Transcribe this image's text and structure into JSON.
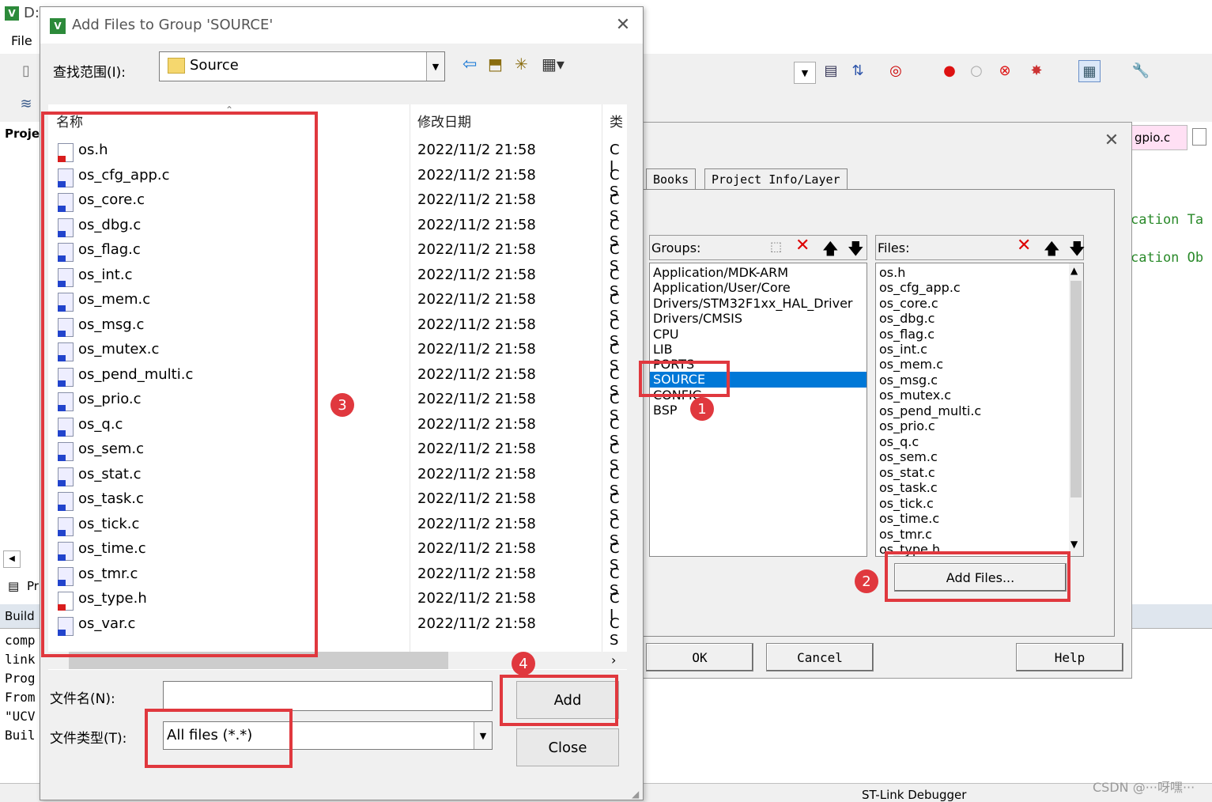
{
  "ide": {
    "title_fragment": "D:",
    "menu_file": "File",
    "project_tab_label": "Projec",
    "project_bottom_tab": "Pr",
    "build_label": "Build",
    "build_lines": [
      "comp",
      "link",
      "Prog",
      "From",
      "\"UCV",
      "Buil"
    ],
    "editor_tab": "gpio.c",
    "code_lines": [
      "cation Ta",
      "cation Ob"
    ],
    "status_right": "ST-Link Debugger",
    "watermark": "CSDN @···呀嘿···"
  },
  "add_dialog": {
    "title": "Add Files to Group 'SOURCE'",
    "lookin_label": "查找范围(I):",
    "lookin_value": "Source",
    "columns": {
      "name": "名称",
      "date": "修改日期",
      "type": "类"
    },
    "files": [
      {
        "name": "os.h",
        "date": "2022/11/2 21:58",
        "type": "C I",
        "kind": "h"
      },
      {
        "name": "os_cfg_app.c",
        "date": "2022/11/2 21:58",
        "type": "C S",
        "kind": "c"
      },
      {
        "name": "os_core.c",
        "date": "2022/11/2 21:58",
        "type": "C S",
        "kind": "c"
      },
      {
        "name": "os_dbg.c",
        "date": "2022/11/2 21:58",
        "type": "C S",
        "kind": "c"
      },
      {
        "name": "os_flag.c",
        "date": "2022/11/2 21:58",
        "type": "C S",
        "kind": "c"
      },
      {
        "name": "os_int.c",
        "date": "2022/11/2 21:58",
        "type": "C S",
        "kind": "c"
      },
      {
        "name": "os_mem.c",
        "date": "2022/11/2 21:58",
        "type": "C S",
        "kind": "c"
      },
      {
        "name": "os_msg.c",
        "date": "2022/11/2 21:58",
        "type": "C S",
        "kind": "c"
      },
      {
        "name": "os_mutex.c",
        "date": "2022/11/2 21:58",
        "type": "C S",
        "kind": "c"
      },
      {
        "name": "os_pend_multi.c",
        "date": "2022/11/2 21:58",
        "type": "C S",
        "kind": "c"
      },
      {
        "name": "os_prio.c",
        "date": "2022/11/2 21:58",
        "type": "C S",
        "kind": "c"
      },
      {
        "name": "os_q.c",
        "date": "2022/11/2 21:58",
        "type": "C S",
        "kind": "c"
      },
      {
        "name": "os_sem.c",
        "date": "2022/11/2 21:58",
        "type": "C S",
        "kind": "c"
      },
      {
        "name": "os_stat.c",
        "date": "2022/11/2 21:58",
        "type": "C S",
        "kind": "c"
      },
      {
        "name": "os_task.c",
        "date": "2022/11/2 21:58",
        "type": "C S",
        "kind": "c"
      },
      {
        "name": "os_tick.c",
        "date": "2022/11/2 21:58",
        "type": "C S",
        "kind": "c"
      },
      {
        "name": "os_time.c",
        "date": "2022/11/2 21:58",
        "type": "C S",
        "kind": "c"
      },
      {
        "name": "os_tmr.c",
        "date": "2022/11/2 21:58",
        "type": "C S",
        "kind": "c"
      },
      {
        "name": "os_type.h",
        "date": "2022/11/2 21:58",
        "type": "C I",
        "kind": "h"
      },
      {
        "name": "os_var.c",
        "date": "2022/11/2 21:58",
        "type": "C S",
        "kind": "c"
      }
    ],
    "filename_label": "文件名(N):",
    "filename_value": "",
    "filetype_label": "文件类型(T):",
    "filetype_value": "All files (*.*)",
    "add_button": "Add",
    "close_button": "Close"
  },
  "proj_dialog": {
    "tabs": [
      "Books",
      "Project Info/Layer"
    ],
    "groups_label": "Groups:",
    "groups": [
      "Application/MDK-ARM",
      "Application/User/Core",
      "Drivers/STM32F1xx_HAL_Driver",
      "Drivers/CMSIS",
      "CPU",
      "LIB",
      "PORTS",
      "SOURCE",
      "CONFIG",
      "BSP"
    ],
    "selected_group": "SOURCE",
    "files_label": "Files:",
    "files": [
      "os.h",
      "os_cfg_app.c",
      "os_core.c",
      "os_dbg.c",
      "os_flag.c",
      "os_int.c",
      "os_mem.c",
      "os_msg.c",
      "os_mutex.c",
      "os_pend_multi.c",
      "os_prio.c",
      "os_q.c",
      "os_sem.c",
      "os_stat.c",
      "os_task.c",
      "os_tick.c",
      "os_time.c",
      "os_tmr.c",
      "os_type.h"
    ],
    "add_files_button": "Add Files...",
    "ok_button": "OK",
    "cancel_button": "Cancel",
    "help_button": "Help"
  },
  "annotations": {
    "badge1": "1",
    "badge2": "2",
    "badge3": "3",
    "badge4": "4"
  },
  "colors": {
    "highlight": "#e0383e",
    "selection": "#0078d7"
  }
}
